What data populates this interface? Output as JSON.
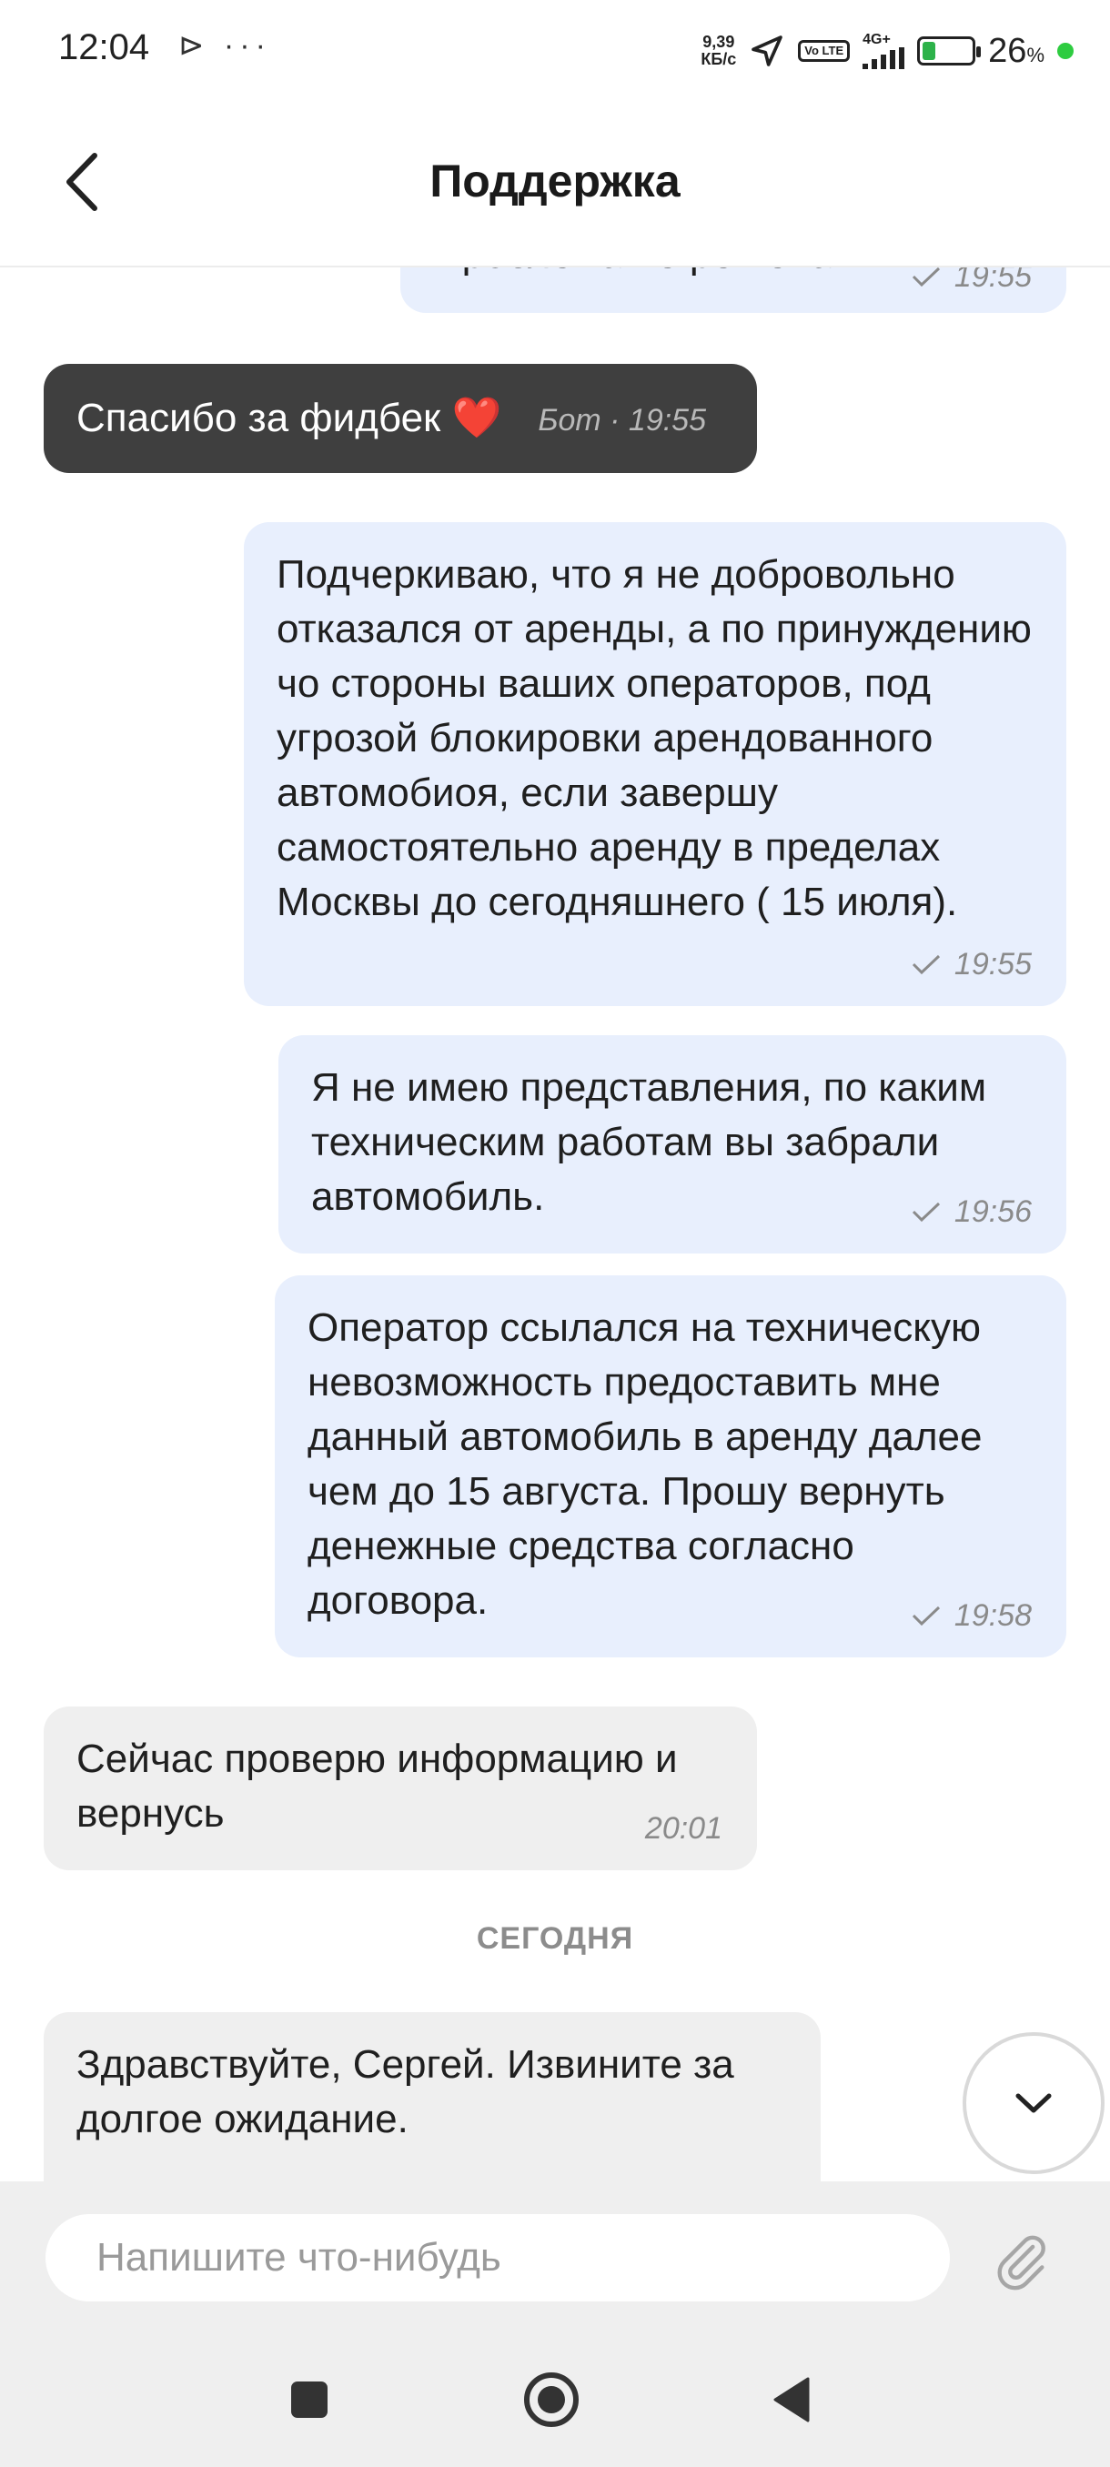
{
  "status_bar": {
    "time": "12:04",
    "left_icons": "⊳ ···",
    "net_speed_value": "9,39",
    "net_speed_unit": "КБ/с",
    "volte": "Vo LTE",
    "network": "4G+",
    "battery_level": 0.26,
    "battery_percent": "26",
    "battery_percent_sign": "%"
  },
  "header": {
    "title": "Поддержка"
  },
  "messages": [
    {
      "direction": "outgoing",
      "text": "Проблема не решена",
      "time": "19:55",
      "read": true
    },
    {
      "direction": "bot",
      "text": "Спасибо за фидбек ❤️",
      "sender": "Бот",
      "separator": " · ",
      "time": "19:55"
    },
    {
      "direction": "outgoing",
      "text": "Подчеркиваю, что я не добровольно отказался от аренды, а по принуждению чо стороны ваших операторов, под угрозой блокировки арендованного автомобиоя, если завершу самостоятельно аренду в пределах Москвы до сегодняшнего ( 15 июля).",
      "time": "19:55",
      "read": true
    },
    {
      "direction": "outgoing",
      "text": "Я не имею представления, по каким техническим работам вы забрали автомобиль.",
      "time": "19:56",
      "read": true
    },
    {
      "direction": "outgoing",
      "text": "Оператор ссылался на техническую невозможность предоставить мне данный автомобиль в аренду далее чем до 15 августа. Прошу вернуть денежные средства согласно договора.",
      "time": "19:58",
      "read": true
    },
    {
      "direction": "incoming",
      "text": "Сейчас проверю информацию и вернусь",
      "time": "20:01"
    },
    {
      "direction": "incoming",
      "text": "Здравствуйте, Сергей. Извините за долгое ожидание."
    }
  ],
  "date_separator": "СЕГОДНЯ",
  "composer": {
    "placeholder": "Напишите что-нибудь"
  },
  "icons": {
    "back": "chevron-left-icon",
    "scroll_down": "chevron-down-icon",
    "attach": "paperclip-icon",
    "nav_recents": "square-icon",
    "nav_home": "circle-icon",
    "nav_back": "triangle-left-icon"
  },
  "colors": {
    "outgoing_bubble": "#e8effd",
    "incoming_bubble": "#efefef",
    "bot_bubble": "#3f3f3f",
    "battery": "#2db24a"
  }
}
